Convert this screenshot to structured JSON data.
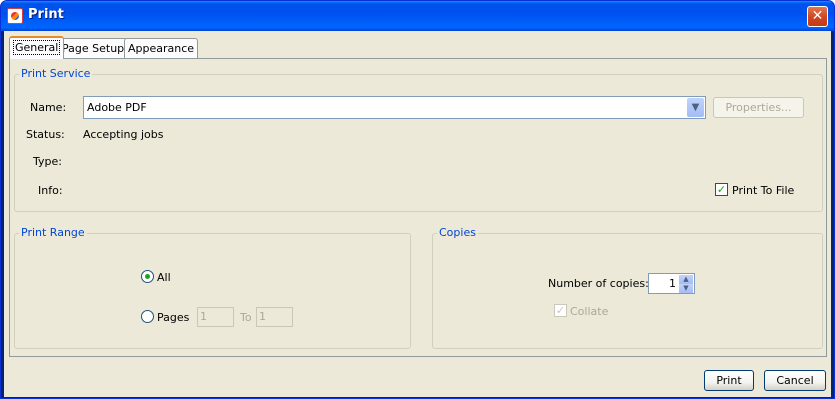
{
  "window": {
    "title": "Print"
  },
  "tabs": [
    {
      "label": "General"
    },
    {
      "label": "Page Setup"
    },
    {
      "label": "Appearance"
    }
  ],
  "print_service": {
    "legend": "Print Service",
    "name_label": "Name:",
    "name_value": "Adobe PDF",
    "properties_button": "Properties...",
    "status_label": "Status:",
    "status_value": "Accepting jobs",
    "type_label": "Type:",
    "info_label": "Info:",
    "print_to_file_label": "Print To File",
    "print_to_file_checked": true
  },
  "print_range": {
    "legend": "Print Range",
    "all_label": "All",
    "pages_label": "Pages",
    "from_value": "1",
    "to_label": "To",
    "to_value": "1",
    "selected": "All"
  },
  "copies": {
    "legend": "Copies",
    "number_label": "Number of copies:",
    "number_value": "1",
    "collate_label": "Collate",
    "collate_checked": true
  },
  "footer": {
    "print_button": "Print",
    "cancel_button": "Cancel"
  },
  "colors": {
    "legend_blue": "#0046d5",
    "titlebar": "#0053ee",
    "face": "#ece9d8"
  }
}
